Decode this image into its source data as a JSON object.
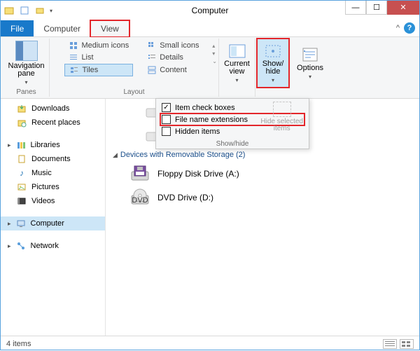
{
  "titlebar": {
    "title": "Computer"
  },
  "tabs": {
    "file": "File",
    "computer": "Computer",
    "view": "View"
  },
  "ribbon": {
    "navpane": "Navigation\npane",
    "panes_label": "Panes",
    "layout": {
      "medium": "Medium icons",
      "small": "Small icons",
      "list": "List",
      "details": "Details",
      "tiles": "Tiles",
      "content": "Content",
      "label": "Layout"
    },
    "current_view": "Current\nview",
    "show_hide": "Show/\nhide",
    "options": "Options"
  },
  "dropdown": {
    "item_check": "Item check boxes",
    "file_ext": "File name extensions",
    "hidden": "Hidden items",
    "hide_sel": "Hide selected\nitems",
    "label": "Show/hide"
  },
  "sidebar": {
    "downloads": "Downloads",
    "recent": "Recent places",
    "libraries": "Libraries",
    "documents": "Documents",
    "music": "Music",
    "pictures": "Pictures",
    "videos": "Videos",
    "computer": "Computer",
    "network": "Network"
  },
  "main": {
    "devices_header": "Devices with Removable Storage (2)",
    "floppy": "Floppy Disk Drive (A:)",
    "dvd": "DVD Drive (D:)"
  },
  "statusbar": {
    "count": "4 items"
  }
}
